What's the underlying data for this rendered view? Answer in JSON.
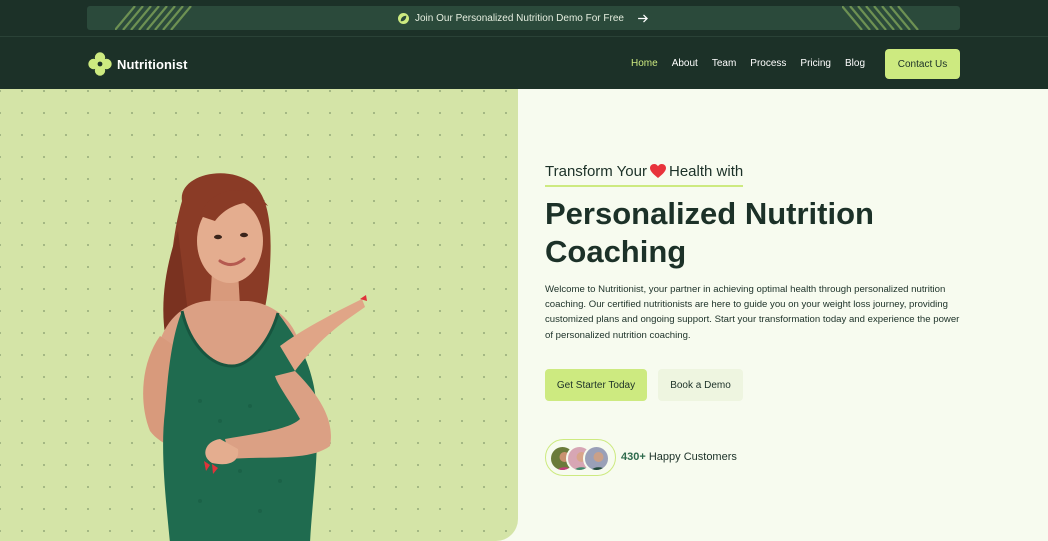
{
  "banner": {
    "text": "Join Our Personalized Nutrition Demo For Free",
    "icon": "leaf-icon",
    "arrow_icon": "arrow-right-icon"
  },
  "nav": {
    "logo_text": "Nutritionist",
    "logo_icon": "clover-logo-icon",
    "items": [
      {
        "label": "Home",
        "active": true
      },
      {
        "label": "About",
        "active": false
      },
      {
        "label": "Team",
        "active": false
      },
      {
        "label": "Process",
        "active": false
      },
      {
        "label": "Pricing",
        "active": false
      },
      {
        "label": "Blog",
        "active": false
      }
    ],
    "contact_label": "Contact Us"
  },
  "hero": {
    "eyebrow_before": "Transform Your",
    "eyebrow_icon": "heart-icon",
    "eyebrow_after": "Health with",
    "headline": "Personalized Nutrition Coaching",
    "description": "Welcome to Nutritionist, your partner in achieving optimal health through personalized nutrition coaching. Our certified nutritionists are here to guide you on your weight loss journey, providing customized plans and ongoing support. Start your transformation today and experience the power of personalized nutrition coaching.",
    "primary_cta": "Get Starter Today",
    "secondary_cta": "Book a Demo",
    "customers_count": "430+",
    "customers_label": "Happy Customers"
  },
  "colors": {
    "dark_green": "#1c3128",
    "accent_lime": "#cdea80",
    "hero_panel": "#d4e4a7",
    "hero_bg": "#f7fbef"
  }
}
